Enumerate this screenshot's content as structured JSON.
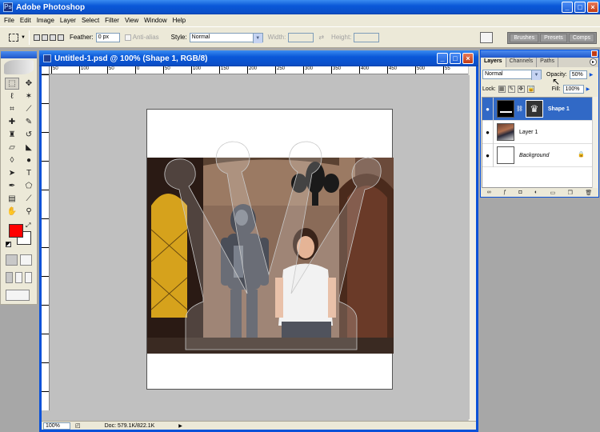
{
  "app": {
    "title": "Adobe Photoshop"
  },
  "menu": [
    "File",
    "Edit",
    "Image",
    "Layer",
    "Select",
    "Filter",
    "View",
    "Window",
    "Help"
  ],
  "options": {
    "feather_label": "Feather:",
    "feather_value": "0 px",
    "antialias_label": "Anti-alias",
    "style_label": "Style:",
    "style_value": "Normal",
    "width_label": "Width:",
    "height_label": "Height:",
    "well_tabs": [
      "Brushes",
      "Presets",
      "Comps"
    ]
  },
  "document": {
    "title": "Untitled-1.psd @ 100% (Shape 1, RGB/8)",
    "ruler_ticks": [
      "50",
      "100",
      "50",
      "0",
      "50",
      "100",
      "150",
      "200",
      "250",
      "300",
      "350",
      "400",
      "450",
      "500",
      "55"
    ],
    "zoom": "100%",
    "doc_info": "Doc: 579.1K/822.1K"
  },
  "layers_panel": {
    "tabs": [
      "Layers",
      "Channels",
      "Paths"
    ],
    "blend_mode": "Normal",
    "opacity_label": "Opacity:",
    "opacity_value": "50%",
    "lock_label": "Lock:",
    "fill_label": "Fill:",
    "fill_value": "100%",
    "layers": [
      {
        "name": "Shape 1",
        "selected": true
      },
      {
        "name": "Layer 1",
        "selected": false
      },
      {
        "name": "Background",
        "selected": false
      }
    ]
  },
  "colors": {
    "foreground": "#ff0000",
    "background": "#ffffff",
    "accent": "#0b52d8"
  }
}
